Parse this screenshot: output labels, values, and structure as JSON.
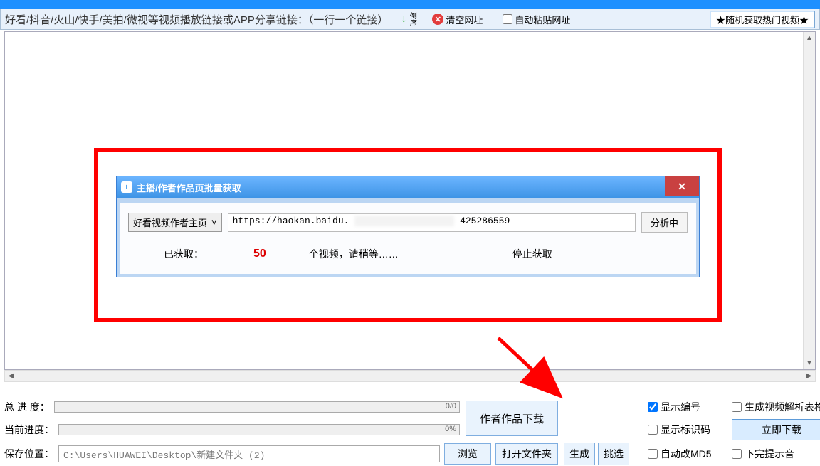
{
  "toolbar": {
    "hint": "好看/抖音/火山/快手/美拍/微视等视频播放链接或APP分享链接：（一行一个链接）",
    "sort_label": "倒序",
    "clear_label": "清空网址",
    "auto_paste_label": "自动粘贴网址",
    "hot_button": "★随机获取热门视频★"
  },
  "dialog": {
    "title": "主播/作者作品页批量获取",
    "select_value": "好看视频作者主页",
    "url_prefix": "https://haokan.baidu.",
    "url_suffix": "425286559",
    "analyze_label": "分析中",
    "got_label": "已获取：",
    "count": "50",
    "wait_label": "个视频，请稍等……",
    "stop_label": "停止获取"
  },
  "bottom": {
    "total_label": "总 进 度：",
    "total_text": "0/0",
    "current_label": "当前进度：",
    "current_text": "0%",
    "save_label": "保存位置：",
    "save_path": "C:\\Users\\HUAWEI\\Desktop\\新建文件夹 (2)",
    "browse": "浏览",
    "open_folder": "打开文件夹",
    "gen": "生成",
    "pick": "挑选",
    "author_download": "作者作品下载",
    "show_index": "显示编号",
    "show_code": "显示标识码",
    "auto_md5": "自动改MD5",
    "gen_table": "生成视频解析表格",
    "download_now": "立即下载",
    "done_sound": "下完提示音"
  }
}
